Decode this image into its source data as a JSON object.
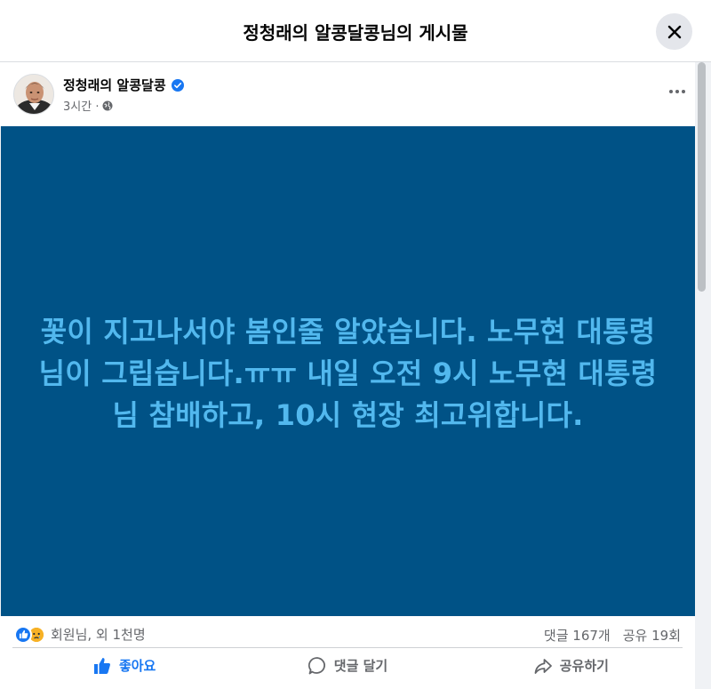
{
  "modal": {
    "title": "정청래의 알콩달콩님의 게시물"
  },
  "post": {
    "author": "정청래의 알콩달콩",
    "time": "3시간 ·",
    "text": "꽃이 지고나서야 봄인줄 알았습니다. 노무현 대통령\n님이 그립습니다.ㅠㅠ 내일 오전 9시 노무현 대통령\n님 참배하고, 10시 현장 최고위합니다.",
    "image_bg_color": "#005286",
    "text_color": "#52b8ee"
  },
  "stats": {
    "reactions_text": "회원님, 외 1천명",
    "comments": "댓글 167개",
    "shares": "공유 19회"
  },
  "actions": {
    "like": "좋아요",
    "comment": "댓글 달기",
    "share": "공유하기"
  },
  "colors": {
    "accent": "#1877f2",
    "secondary_text": "#65676b"
  }
}
